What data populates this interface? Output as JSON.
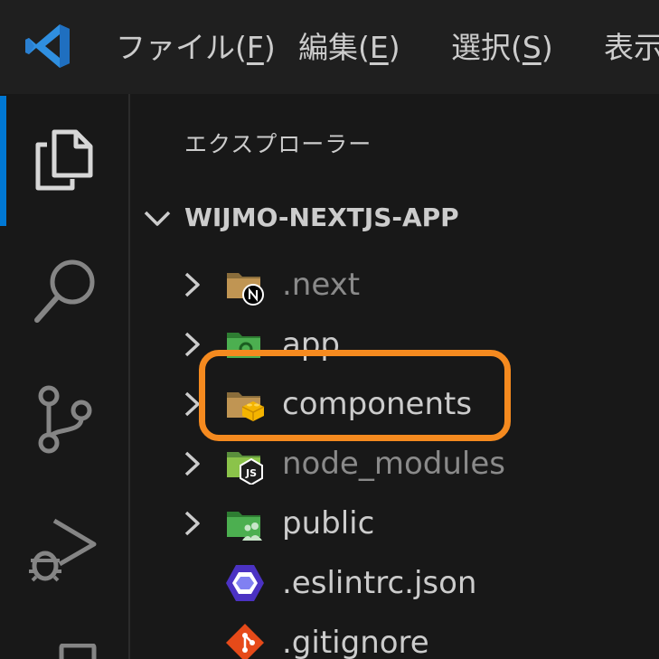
{
  "menu": {
    "items": [
      {
        "label": "ファイル(",
        "mnemonic": "F",
        "tail": ")"
      },
      {
        "label": "編集(",
        "mnemonic": "E",
        "tail": ")"
      },
      {
        "label": "選択(",
        "mnemonic": "S",
        "tail": ")"
      },
      {
        "label": "表示",
        "mnemonic": "",
        "tail": ""
      }
    ]
  },
  "activity_bar": {
    "items": [
      "explorer-icon",
      "search-icon",
      "source-control-icon",
      "run-debug-icon",
      "extensions-icon"
    ]
  },
  "explorer": {
    "title": "エクスプローラー",
    "root_label": "WIJMO-NEXTJS-APP",
    "items": [
      {
        "label": ".next",
        "type": "folder",
        "icon": "nextjs-folder-icon",
        "dimmed": true
      },
      {
        "label": "app",
        "type": "folder",
        "icon": "app-folder-icon",
        "dimmed": false
      },
      {
        "label": "components",
        "type": "folder",
        "icon": "components-folder-icon",
        "dimmed": false,
        "highlighted": true
      },
      {
        "label": "node_modules",
        "type": "folder",
        "icon": "node-modules-folder-icon",
        "dimmed": true
      },
      {
        "label": "public",
        "type": "folder",
        "icon": "public-folder-icon",
        "dimmed": false
      },
      {
        "label": ".eslintrc.json",
        "type": "file",
        "icon": "eslint-file-icon",
        "dimmed": false
      },
      {
        "label": ".gitignore",
        "type": "file",
        "icon": "git-file-icon",
        "dimmed": false
      }
    ]
  },
  "colors": {
    "accent": "#0078d4",
    "highlight": "#f58a1f",
    "folder": "#c09553",
    "green_folder": "#4caf50"
  }
}
